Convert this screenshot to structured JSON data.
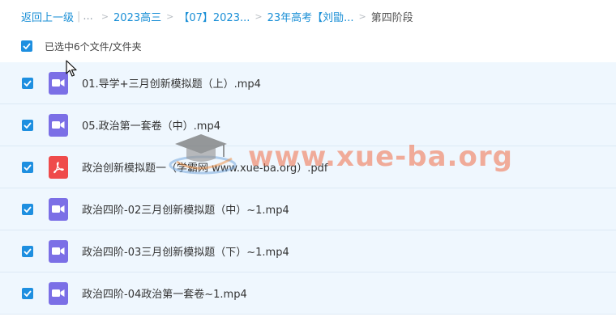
{
  "breadcrumb": {
    "back": "返回上一级",
    "ellipsis": "...",
    "items": [
      "2023高三",
      "【07】2023...",
      "23年高考【刘勖..."
    ],
    "current": "第四阶段"
  },
  "selection": {
    "label": "已选中6个文件/文件夹"
  },
  "files": [
    {
      "name": "01.导学+三月创新模拟题（上）.mp4",
      "type": "video"
    },
    {
      "name": "05.政治第一套卷（中）.mp4",
      "type": "video"
    },
    {
      "name": "政治创新模拟题一（学霸网 www.xue-ba.org）.pdf",
      "type": "pdf"
    },
    {
      "name": "政治四阶-02三月创新模拟题（中）~1.mp4",
      "type": "video"
    },
    {
      "name": "政治四阶-03三月创新模拟题（下）~1.mp4",
      "type": "video"
    },
    {
      "name": "政治四阶-04政治第一套卷~1.mp4",
      "type": "video"
    }
  ],
  "watermark": {
    "text": "www.xue-ba.org"
  }
}
